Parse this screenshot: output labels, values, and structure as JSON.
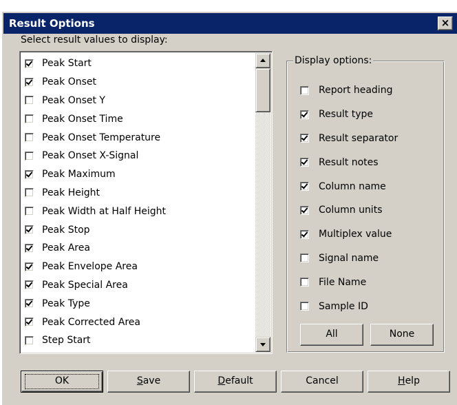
{
  "window": {
    "title": "Result Options",
    "close_glyph": "×"
  },
  "list": {
    "label": "Select result values to display:",
    "items": [
      {
        "label": "Peak Start",
        "checked": true
      },
      {
        "label": "Peak Onset",
        "checked": true
      },
      {
        "label": "Peak Onset Y",
        "checked": false
      },
      {
        "label": "Peak Onset Time",
        "checked": false
      },
      {
        "label": "Peak Onset Temperature",
        "checked": false
      },
      {
        "label": "Peak Onset X-Signal",
        "checked": false
      },
      {
        "label": "Peak Maximum",
        "checked": true
      },
      {
        "label": "Peak Height",
        "checked": false
      },
      {
        "label": "Peak Width at Half Height",
        "checked": false
      },
      {
        "label": "Peak Stop",
        "checked": true
      },
      {
        "label": "Peak Area",
        "checked": true
      },
      {
        "label": "Peak Envelope Area",
        "checked": true
      },
      {
        "label": "Peak Special Area",
        "checked": true
      },
      {
        "label": "Peak Type",
        "checked": true
      },
      {
        "label": "Peak Corrected Area",
        "checked": true
      },
      {
        "label": "Step Start",
        "checked": false
      }
    ]
  },
  "display_options": {
    "legend": "Display options:",
    "items": [
      {
        "label": "Report heading",
        "checked": false
      },
      {
        "label": "Result type",
        "checked": true
      },
      {
        "label": "Result separator",
        "checked": true
      },
      {
        "label": "Result notes",
        "checked": true
      },
      {
        "label": "Column name",
        "checked": true
      },
      {
        "label": "Column units",
        "checked": true
      },
      {
        "label": "Multiplex value",
        "checked": true
      },
      {
        "label": "Signal name",
        "checked": false
      },
      {
        "label": "File Name",
        "checked": false
      },
      {
        "label": "Sample ID",
        "checked": false
      }
    ],
    "all_label": "All",
    "none_label": "None"
  },
  "buttons": {
    "ok": "OK",
    "save": "Save",
    "default": "Default",
    "cancel": "Cancel",
    "help": "Help"
  },
  "colors": {
    "titlebar": "#0a246a",
    "face": "#d4d0c8"
  }
}
